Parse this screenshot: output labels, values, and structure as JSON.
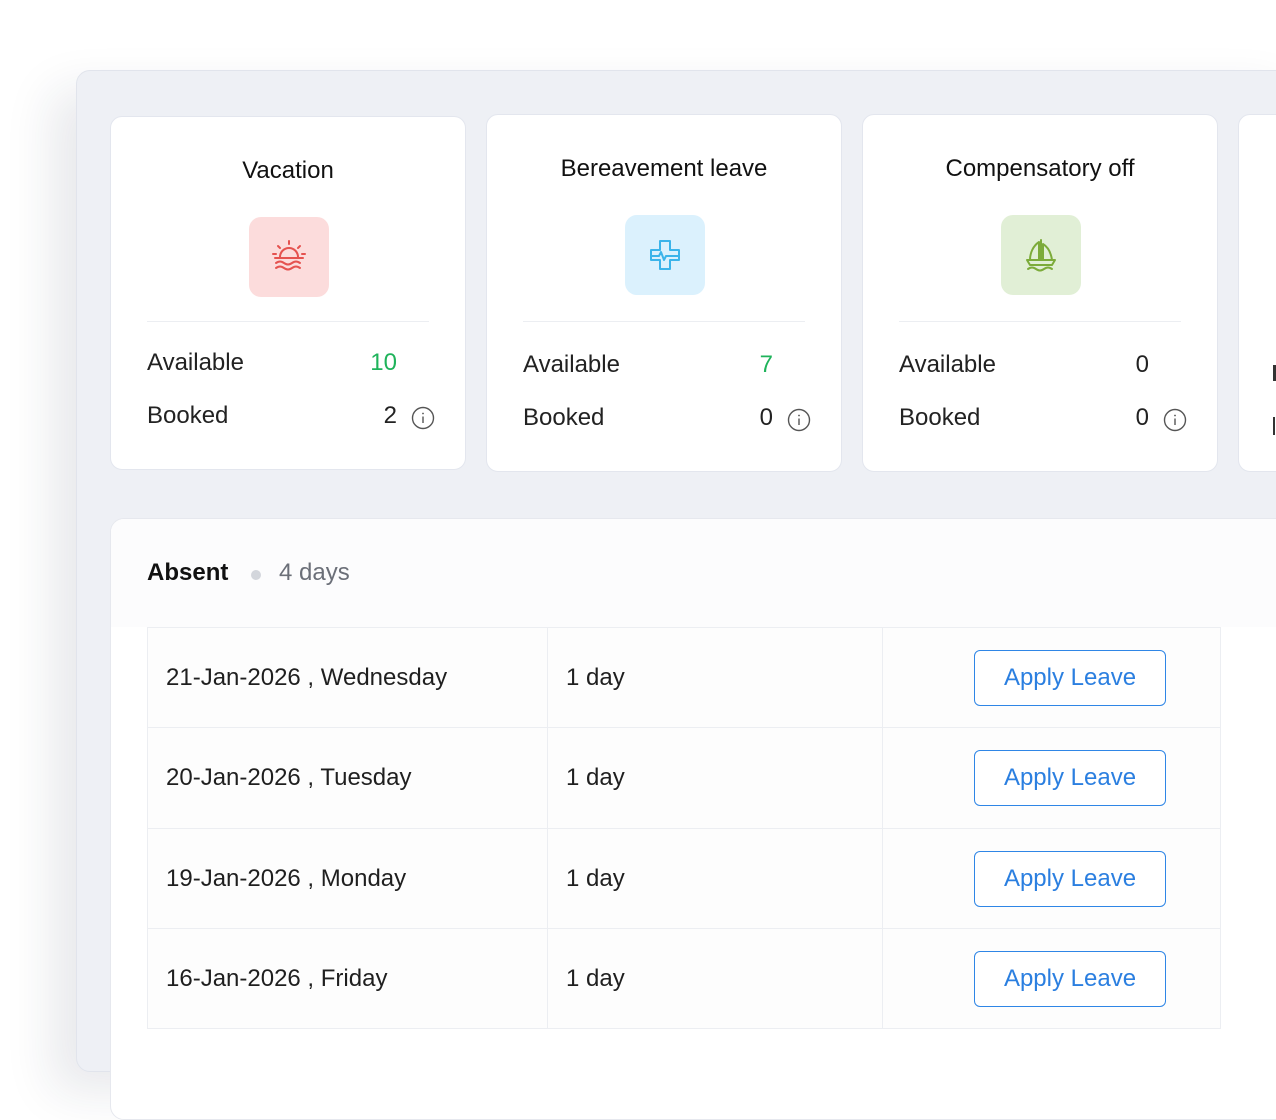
{
  "leave_cards": [
    {
      "title": "Vacation",
      "icon": "sunset-icon",
      "tile_color": "#fcdcdc",
      "icon_color": "#e5524f",
      "available_label": "Available",
      "available": "10",
      "available_color": "#1fb35b",
      "booked_label": "Booked",
      "booked": "2"
    },
    {
      "title": "Bereavement leave",
      "icon": "medical-cross-icon",
      "tile_color": "#dbf1fd",
      "icon_color": "#3bb4ea",
      "available_label": "Available",
      "available": "7",
      "available_color": "#1fb35b",
      "booked_label": "Booked",
      "booked": "0"
    },
    {
      "title": "Compensatory off",
      "icon": "sailboat-icon",
      "tile_color": "#e1efd6",
      "icon_color": "#7cab3a",
      "available_label": "Available",
      "available": "0",
      "available_color": "#222222",
      "booked_label": "Booked",
      "booked": "0"
    }
  ],
  "absent": {
    "title": "Absent",
    "count": "4 days",
    "rows": [
      {
        "date": "21-Jan-2026 , Wednesday",
        "duration": "1 day",
        "action": "Apply Leave"
      },
      {
        "date": "20-Jan-2026 , Tuesday",
        "duration": "1 day",
        "action": "Apply Leave"
      },
      {
        "date": "19-Jan-2026 , Monday",
        "duration": "1 day",
        "action": "Apply Leave"
      },
      {
        "date": "16-Jan-2026 , Friday",
        "duration": "1 day",
        "action": "Apply Leave"
      }
    ]
  },
  "colors": {
    "accent_blue": "#2b7fe0",
    "available_green": "#1fb35b",
    "background": "#eef0f5"
  }
}
